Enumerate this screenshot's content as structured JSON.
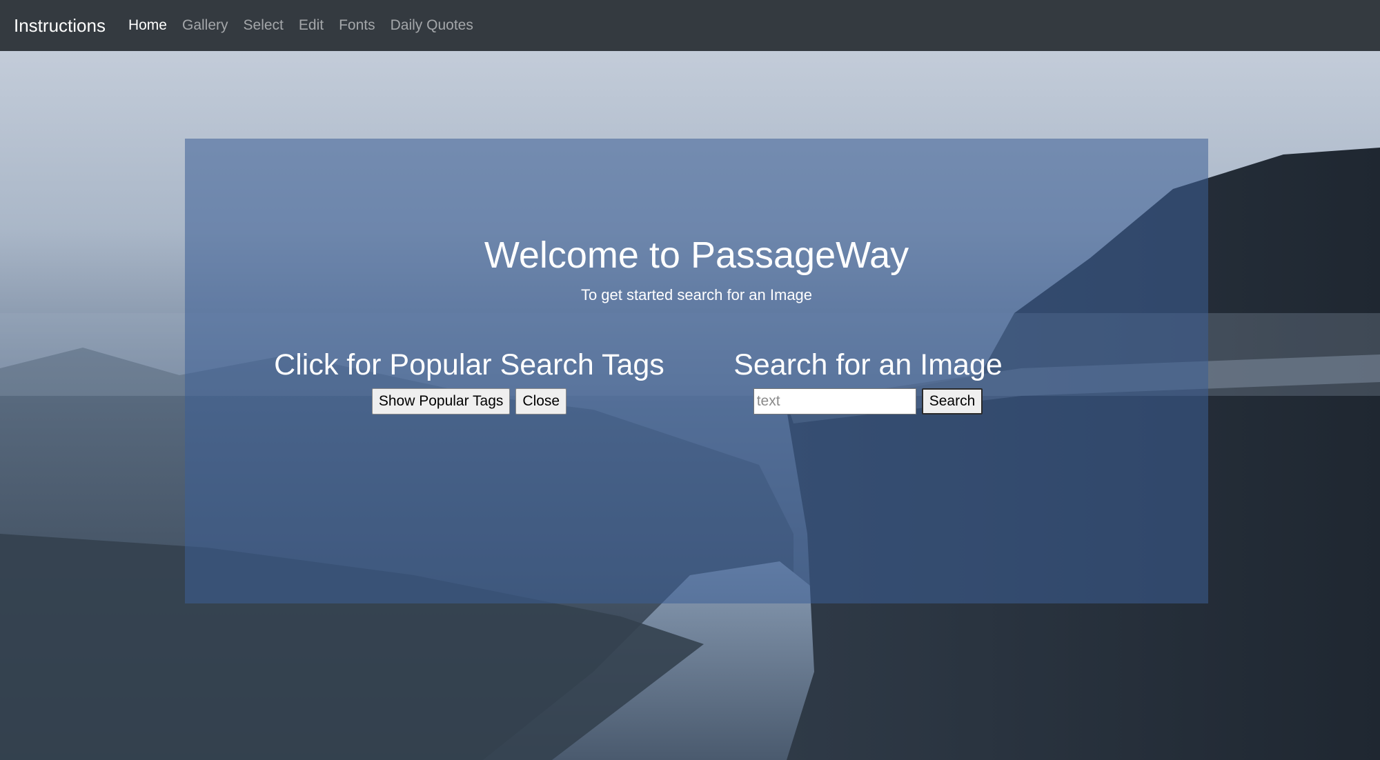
{
  "navbar": {
    "brand": "Instructions",
    "links": [
      {
        "label": "Home",
        "active": true
      },
      {
        "label": "Gallery",
        "active": false
      },
      {
        "label": "Select",
        "active": false
      },
      {
        "label": "Edit",
        "active": false
      },
      {
        "label": "Fonts",
        "active": false
      },
      {
        "label": "Daily Quotes",
        "active": false
      }
    ]
  },
  "hero": {
    "title": "Welcome to PassageWay",
    "subtitle": "To get started search for an Image"
  },
  "popular_tags": {
    "heading": "Click for Popular Search Tags",
    "show_button": "Show Popular Tags",
    "close_button": "Close"
  },
  "search": {
    "heading": "Search for an Image",
    "placeholder": "text",
    "value": "",
    "button": "Search"
  },
  "colors": {
    "navbar_bg": "#343a40",
    "panel_overlay": "rgba(60, 95, 150, 0.55)",
    "text": "#ffffff"
  },
  "icons": {
    "background": "mountain-fjord-photo"
  }
}
